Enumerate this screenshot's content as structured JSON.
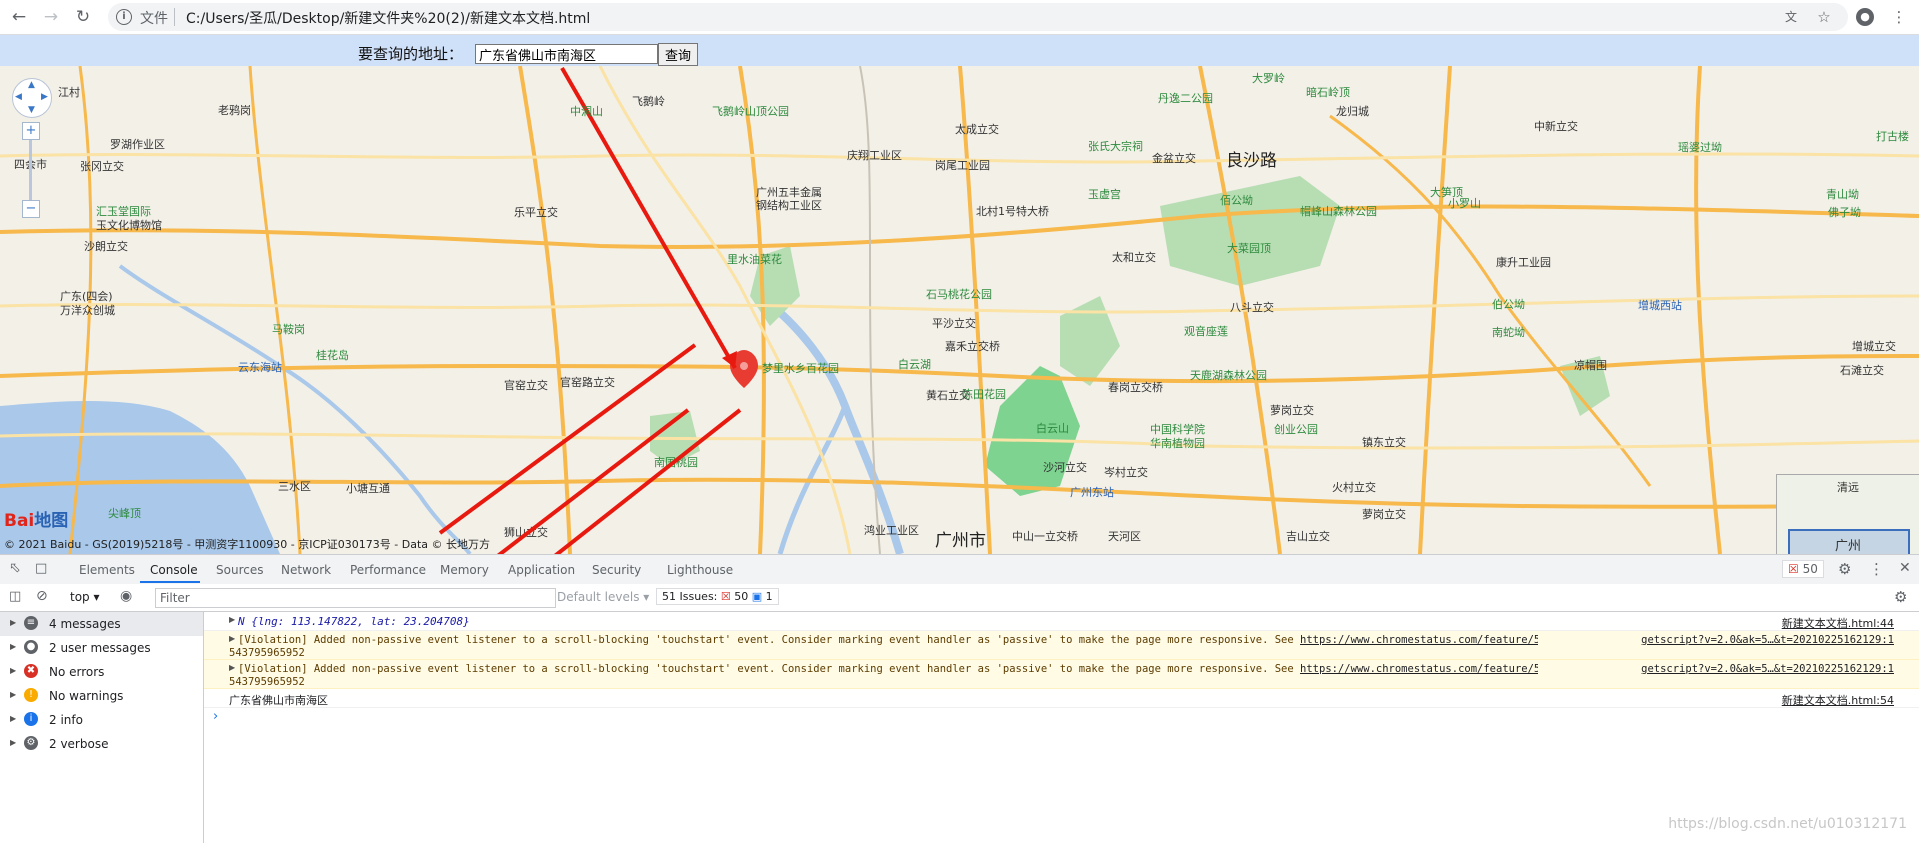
{
  "browser": {
    "scheme_label": "文件",
    "url": "C:/Users/圣瓜/Desktop/新建文件夹%20(2)/新建文本文档.html"
  },
  "page": {
    "search_label": "要查询的地址：",
    "search_value": "广东省佛山市南海区",
    "search_button": "查询"
  },
  "map": {
    "labels": [
      {
        "t": "江村",
        "c": ""
      },
      {
        "t": "老鸦岗",
        "c": ""
      },
      {
        "t": "罗湖作业区",
        "c": ""
      },
      {
        "t": "四会市",
        "c": ""
      },
      {
        "t": "张冈立交",
        "c": ""
      },
      {
        "t": "汇玉堂国际",
        "c": "green"
      },
      {
        "t": "玉文化博物馆",
        "c": ""
      },
      {
        "t": "沙朗立交",
        "c": ""
      },
      {
        "t": "广东(四会)",
        "c": ""
      },
      {
        "t": "万洋众创城",
        "c": ""
      },
      {
        "t": "马鞍岗",
        "c": "green"
      },
      {
        "t": "桂花岛",
        "c": "green"
      },
      {
        "t": "云东海站",
        "c": "blue"
      },
      {
        "t": "尖峰顶",
        "c": "green"
      },
      {
        "t": "三水区",
        "c": ""
      },
      {
        "t": "小塘互通",
        "c": ""
      },
      {
        "t": "中洞山",
        "c": "green"
      },
      {
        "t": "飞鹅岭",
        "c": ""
      },
      {
        "t": "飞鹅岭山顶公园",
        "c": "green"
      },
      {
        "t": "乐平立交",
        "c": ""
      },
      {
        "t": "里水油菜花",
        "c": "green"
      },
      {
        "t": "官窑立交",
        "c": ""
      },
      {
        "t": "官窑路立交",
        "c": ""
      },
      {
        "t": "南国桃园",
        "c": "green"
      },
      {
        "t": "狮山立交",
        "c": ""
      },
      {
        "t": "广州五丰金属",
        "c": ""
      },
      {
        "t": "钢结构工业区",
        "c": ""
      },
      {
        "t": "庆翔工业区",
        "c": ""
      },
      {
        "t": "梦里水乡百花园",
        "c": "green"
      },
      {
        "t": "石马桃花公园",
        "c": "green"
      },
      {
        "t": "白云湖",
        "c": "green"
      },
      {
        "t": "嘉禾立交桥",
        "c": ""
      },
      {
        "t": "平沙立交",
        "c": ""
      },
      {
        "t": "黄石立交",
        "c": ""
      },
      {
        "t": "陈田花园",
        "c": "green"
      },
      {
        "t": "白云山",
        "c": "green"
      },
      {
        "t": "沙河立交",
        "c": ""
      },
      {
        "t": "广州东站",
        "c": "blue"
      },
      {
        "t": "中山一立交桥",
        "c": ""
      },
      {
        "t": "广州市",
        "c": "big"
      },
      {
        "t": "鸿业工业区",
        "c": ""
      },
      {
        "t": "太成立交",
        "c": ""
      },
      {
        "t": "岗尾工业园",
        "c": ""
      },
      {
        "t": "北村1号特大桥",
        "c": ""
      },
      {
        "t": "丹逸二公园",
        "c": "green"
      },
      {
        "t": "张氏大宗祠",
        "c": "green"
      },
      {
        "t": "玉虚宫",
        "c": "green"
      },
      {
        "t": "金盆立交",
        "c": ""
      },
      {
        "t": "良沙路",
        "c": "big"
      },
      {
        "t": "佰公坳",
        "c": "green"
      },
      {
        "t": "帽峰山森林公园",
        "c": "green"
      },
      {
        "t": "大菜园顶",
        "c": "green"
      },
      {
        "t": "太和立交",
        "c": ""
      },
      {
        "t": "八斗立交",
        "c": ""
      },
      {
        "t": "观音座莲",
        "c": "green"
      },
      {
        "t": "天鹿湖森林公园",
        "c": "green"
      },
      {
        "t": "春岗立交桥",
        "c": ""
      },
      {
        "t": "中国科学院",
        "c": "green"
      },
      {
        "t": "华南植物园",
        "c": "green"
      },
      {
        "t": "岑村立交",
        "c": ""
      },
      {
        "t": "天河区",
        "c": ""
      },
      {
        "t": "萝岗立交",
        "c": ""
      },
      {
        "t": "创业公园",
        "c": "green"
      },
      {
        "t": "火村立交",
        "c": ""
      },
      {
        "t": "萝岗立交",
        "c": ""
      },
      {
        "t": "吉山立交",
        "c": ""
      },
      {
        "t": "大罗岭",
        "c": "green"
      },
      {
        "t": "暗石岭顶",
        "c": "green"
      },
      {
        "t": "龙归城",
        "c": ""
      },
      {
        "t": "中新立交",
        "c": ""
      },
      {
        "t": "瑶婆过坳",
        "c": "green"
      },
      {
        "t": "小罗山",
        "c": "green"
      },
      {
        "t": "青山坳",
        "c": "green"
      },
      {
        "t": "佛子坳",
        "c": "green"
      },
      {
        "t": "打古楼",
        "c": "green"
      },
      {
        "t": "康升工业园",
        "c": ""
      },
      {
        "t": "增城西站",
        "c": "blue"
      },
      {
        "t": "伯公坳",
        "c": "green"
      },
      {
        "t": "南蛇坳",
        "c": "green"
      },
      {
        "t": "凉帽围",
        "c": ""
      },
      {
        "t": "增城立交",
        "c": ""
      },
      {
        "t": "石滩立交",
        "c": ""
      },
      {
        "t": "镇东立交",
        "c": ""
      },
      {
        "t": "大笋顶",
        "c": "green"
      },
      {
        "t": "广州",
        "c": ""
      },
      {
        "t": "清远",
        "c": ""
      }
    ],
    "copyright": "© 2021 Baidu - GS(2019)5218号 - 甲测资字1100930 - 京ICP证030173号 - Data © 长地万方",
    "logo_text_red": "Bai",
    "logo_text_blue": "地图"
  },
  "devtools": {
    "tabs": [
      "Elements",
      "Console",
      "Sources",
      "Network",
      "Performance",
      "Memory",
      "Application",
      "Security",
      "Lighthouse"
    ],
    "active_tab": "Console",
    "error_badge": "50",
    "context": "top",
    "filter_placeholder": "Filter",
    "default_levels": "Default levels",
    "issues_label": "51 Issues:",
    "issues_errors": "50",
    "issues_info": "1",
    "sidebar": [
      {
        "label": "4 messages",
        "icon": "list-icon",
        "color": "#5f6368"
      },
      {
        "label": "2 user messages",
        "icon": "user-icon",
        "color": "#5f6368"
      },
      {
        "label": "No errors",
        "icon": "error-icon",
        "color": "#d93025"
      },
      {
        "label": "No warnings",
        "icon": "warning-icon",
        "color": "#f9ab00"
      },
      {
        "label": "2 info",
        "icon": "info-icon",
        "color": "#1a73e8"
      },
      {
        "label": "2 verbose",
        "icon": "bug-icon",
        "color": "#5f6368"
      }
    ],
    "messages": [
      {
        "text": "N {lng: 113.147822, lat: 23.204708}",
        "source": "新建文本文档.html:44"
      },
      {
        "text": "[Violation] Added non-passive event listener to a scroll-blocking 'touchstart' event. Consider marking event handler as 'passive' to make the page more responsive. See",
        "link": "https://www.chromestatus.com/feature/5745",
        "source": "getscript?v=2.0&ak=5…&t=20210225162129:1",
        "cont": "543795965952"
      },
      {
        "text": "[Violation] Added non-passive event listener to a scroll-blocking 'touchstart' event. Consider marking event handler as 'passive' to make the page more responsive. See",
        "link": "https://www.chromestatus.com/feature/5745",
        "source": "getscript?v=2.0&ak=5…&t=20210225162129:1",
        "cont": "543795965952"
      },
      {
        "text": "广东省佛山市南海区",
        "source": "新建文本文档.html:54"
      }
    ]
  },
  "watermark": "https://blog.csdn.net/u010312171"
}
